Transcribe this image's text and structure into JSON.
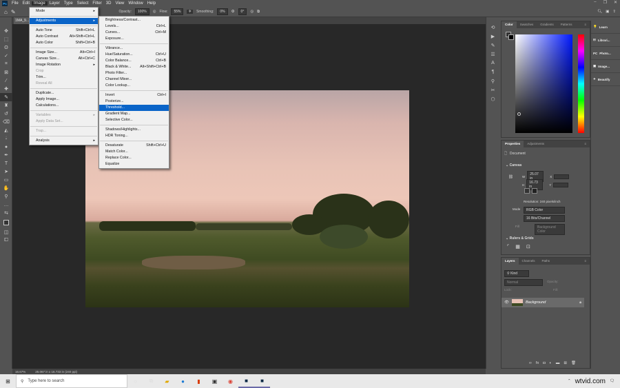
{
  "menubar": {
    "items": [
      "File",
      "Edit",
      "Image",
      "Layer",
      "Type",
      "Select",
      "Filter",
      "3D",
      "View",
      "Window",
      "Help"
    ],
    "logo": "Ps"
  },
  "options": {
    "opacity_label": "Opacity:",
    "opacity": "100%",
    "flow_label": "Flow:",
    "flow": "55%",
    "smoothing_label": "Smoothing:",
    "smoothing": "0%",
    "angle": "0°"
  },
  "document": {
    "tab": "1MA_9..."
  },
  "image_menu": [
    {
      "label": "Mode",
      "sub": true
    },
    {
      "sep": true
    },
    {
      "label": "Adjustments",
      "sub": true,
      "hl": true
    },
    {
      "sep": true
    },
    {
      "label": "Auto Tone",
      "sc": "Shift+Ctrl+L"
    },
    {
      "label": "Auto Contrast",
      "sc": "Alt+Shift+Ctrl+L"
    },
    {
      "label": "Auto Color",
      "sc": "Shift+Ctrl+B"
    },
    {
      "sep": true
    },
    {
      "label": "Image Size...",
      "sc": "Alt+Ctrl+I"
    },
    {
      "label": "Canvas Size...",
      "sc": "Alt+Ctrl+C"
    },
    {
      "label": "Image Rotation",
      "sub": true
    },
    {
      "label": "Crop",
      "dis": true
    },
    {
      "label": "Trim..."
    },
    {
      "label": "Reveal All",
      "dis": true
    },
    {
      "sep": true
    },
    {
      "label": "Duplicate..."
    },
    {
      "label": "Apply Image..."
    },
    {
      "label": "Calculations..."
    },
    {
      "sep": true
    },
    {
      "label": "Variables",
      "sub": true,
      "dis": true
    },
    {
      "label": "Apply Data Set...",
      "dis": true
    },
    {
      "sep": true
    },
    {
      "label": "Trap...",
      "dis": true
    },
    {
      "sep": true
    },
    {
      "label": "Analysis",
      "sub": true
    }
  ],
  "adjustments_menu": [
    {
      "label": "Brightness/Contrast..."
    },
    {
      "label": "Levels...",
      "sc": "Ctrl+L"
    },
    {
      "label": "Curves...",
      "sc": "Ctrl+M"
    },
    {
      "label": "Exposure..."
    },
    {
      "sep": true
    },
    {
      "label": "Vibrance..."
    },
    {
      "label": "Hue/Saturation...",
      "sc": "Ctrl+U"
    },
    {
      "label": "Color Balance...",
      "sc": "Ctrl+B"
    },
    {
      "label": "Black & White...",
      "sc": "Alt+Shift+Ctrl+B"
    },
    {
      "label": "Photo Filter..."
    },
    {
      "label": "Channel Mixer..."
    },
    {
      "label": "Color Lookup..."
    },
    {
      "sep": true
    },
    {
      "label": "Invert",
      "sc": "Ctrl+I"
    },
    {
      "label": "Posterize..."
    },
    {
      "label": "Threshold...",
      "hl": true
    },
    {
      "label": "Gradient Map..."
    },
    {
      "label": "Selective Color..."
    },
    {
      "sep": true
    },
    {
      "label": "Shadows/Highlights..."
    },
    {
      "label": "HDR Toning..."
    },
    {
      "sep": true
    },
    {
      "label": "Desaturate",
      "sc": "Shift+Ctrl+U"
    },
    {
      "label": "Match Color..."
    },
    {
      "label": "Replace Color..."
    },
    {
      "label": "Equalize"
    }
  ],
  "color_panel": {
    "tabs": [
      "Color",
      "Swatches",
      "Gradients",
      "Patterns"
    ]
  },
  "properties": {
    "tabs": [
      "Properties",
      "Adjustments"
    ],
    "doc_label": "Document",
    "canvas_label": "Canvas",
    "w_label": "W",
    "w": "25.07 in",
    "h_label": "H",
    "h": "16.73 in",
    "x_label": "X",
    "y_label": "Y",
    "resolution": "Resolution: 240 pixels/inch",
    "mode_label": "Mode",
    "mode": "RGB Color",
    "depth": "16 Bits/Channel",
    "fill_label": "Fill",
    "fill": "Background Color",
    "rulers_label": "Rulers & Grids"
  },
  "layers": {
    "tabs": [
      "Layers",
      "Channels",
      "Paths"
    ],
    "kind": "Kind",
    "blend": "Normal",
    "opacity_label": "Opacity:",
    "lock_label": "Lock:",
    "fill_label": "Fill:",
    "layer_name": "Background"
  },
  "farright": [
    "Learn",
    "Librari...",
    "Photo...",
    "Image...",
    "Beautify"
  ],
  "status": {
    "zoom": "16.67%",
    "size": "25.067 in x 16.733 in (240 ppi)"
  },
  "taskbar": {
    "search_placeholder": "Type here to search",
    "watermark": "wtvid.com"
  }
}
